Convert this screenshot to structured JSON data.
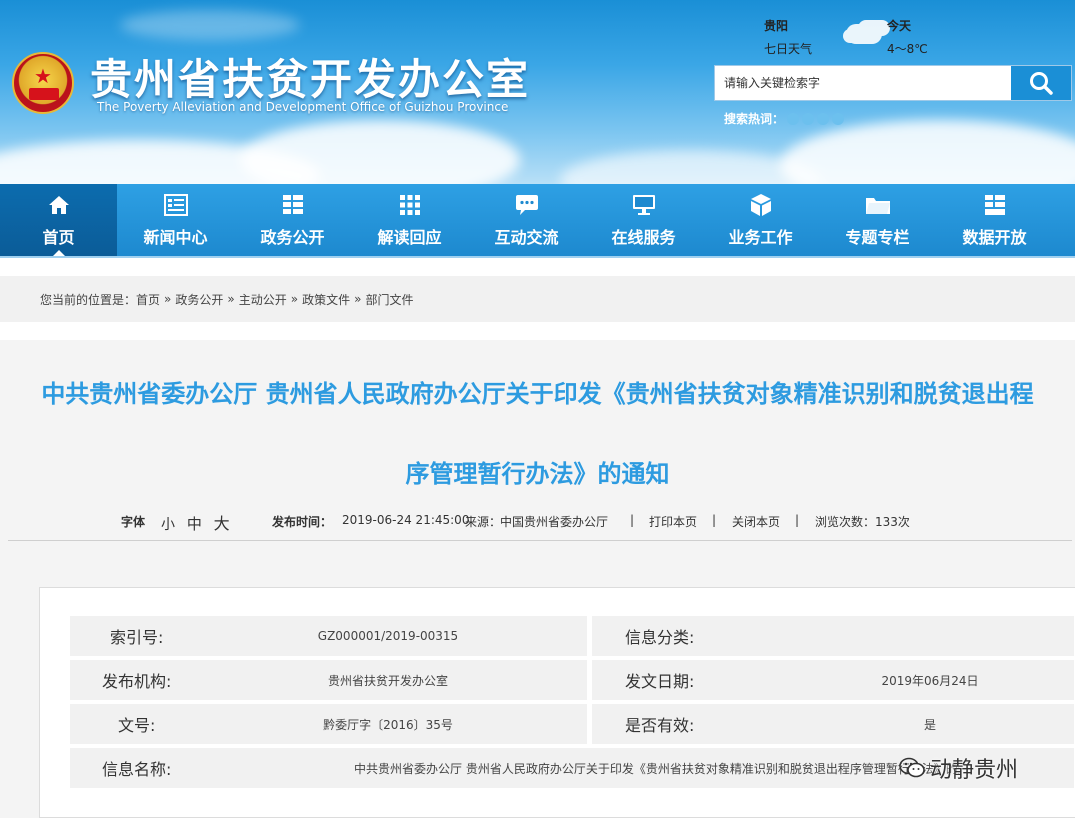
{
  "header": {
    "site_title": "贵州省扶贫开发办公室",
    "site_subtitle": "The Poverty Alleviation and Development Office of Guizhou Province",
    "weather": {
      "city": "贵阳",
      "forecast": "七日天气",
      "today_label": "今天",
      "temperature": "4～8℃"
    },
    "search": {
      "placeholder": "请输入关键检索字",
      "hot_words_label": "搜索热词："
    }
  },
  "nav": {
    "items": [
      {
        "label": "首页",
        "icon": "home-icon"
      },
      {
        "label": "新闻中心",
        "icon": "news-icon"
      },
      {
        "label": "政务公开",
        "icon": "list-icon"
      },
      {
        "label": "解读回应",
        "icon": "grid-icon"
      },
      {
        "label": "互动交流",
        "icon": "chat-icon"
      },
      {
        "label": "在线服务",
        "icon": "monitor-icon"
      },
      {
        "label": "业务工作",
        "icon": "cube-icon"
      },
      {
        "label": "专题专栏",
        "icon": "folder-icon"
      },
      {
        "label": "数据开放",
        "icon": "data-icon"
      }
    ]
  },
  "breadcrumb": {
    "prefix": "您当前的位置是：",
    "items": [
      "首页",
      "政务公开",
      "主动公开",
      "政策文件",
      "部门文件"
    ],
    "separator": "»"
  },
  "article": {
    "title_line1": "中共贵州省委办公厅 贵州省人民政府办公厅关于印发《贵州省扶贫对象精准识别和脱贫退出程",
    "title_line2": "序管理暂行办法》的通知",
    "font_label": "字体",
    "font_sizes": [
      "小",
      "中",
      "大"
    ],
    "publish_label": "发布时间：",
    "publish_time": "2019-06-24 21:45:00",
    "source_label": "来源：",
    "source": "中国贵州省委办公厅",
    "print": "打印本页",
    "close": "关闭本页",
    "views": "浏览次数：133次"
  },
  "info_table": {
    "index_label": "索引号:",
    "index_value": "GZ000001/2019-00315",
    "category_label": "信息分类:",
    "category_value": "",
    "org_label": "发布机构:",
    "org_value": "贵州省扶贫开发办公室",
    "date_label": "发文日期:",
    "date_value": "2019年06月24日",
    "doc_no_label": "文号:",
    "doc_no_value": "黔委厅字〔2016〕35号",
    "valid_label": "是否有效:",
    "valid_value": "是",
    "name_label": "信息名称:",
    "name_value": "中共贵州省委办公厅 贵州省人民政府办公厅关于印发《贵州省扶贫对象精准识别和脱贫退出程序管理暂行办法》的通知"
  },
  "watermark": "动静贵州",
  "colors": {
    "brand_blue": "#1d89cf",
    "title_blue": "#2d9be0",
    "nav_active": "#0b5c98"
  }
}
